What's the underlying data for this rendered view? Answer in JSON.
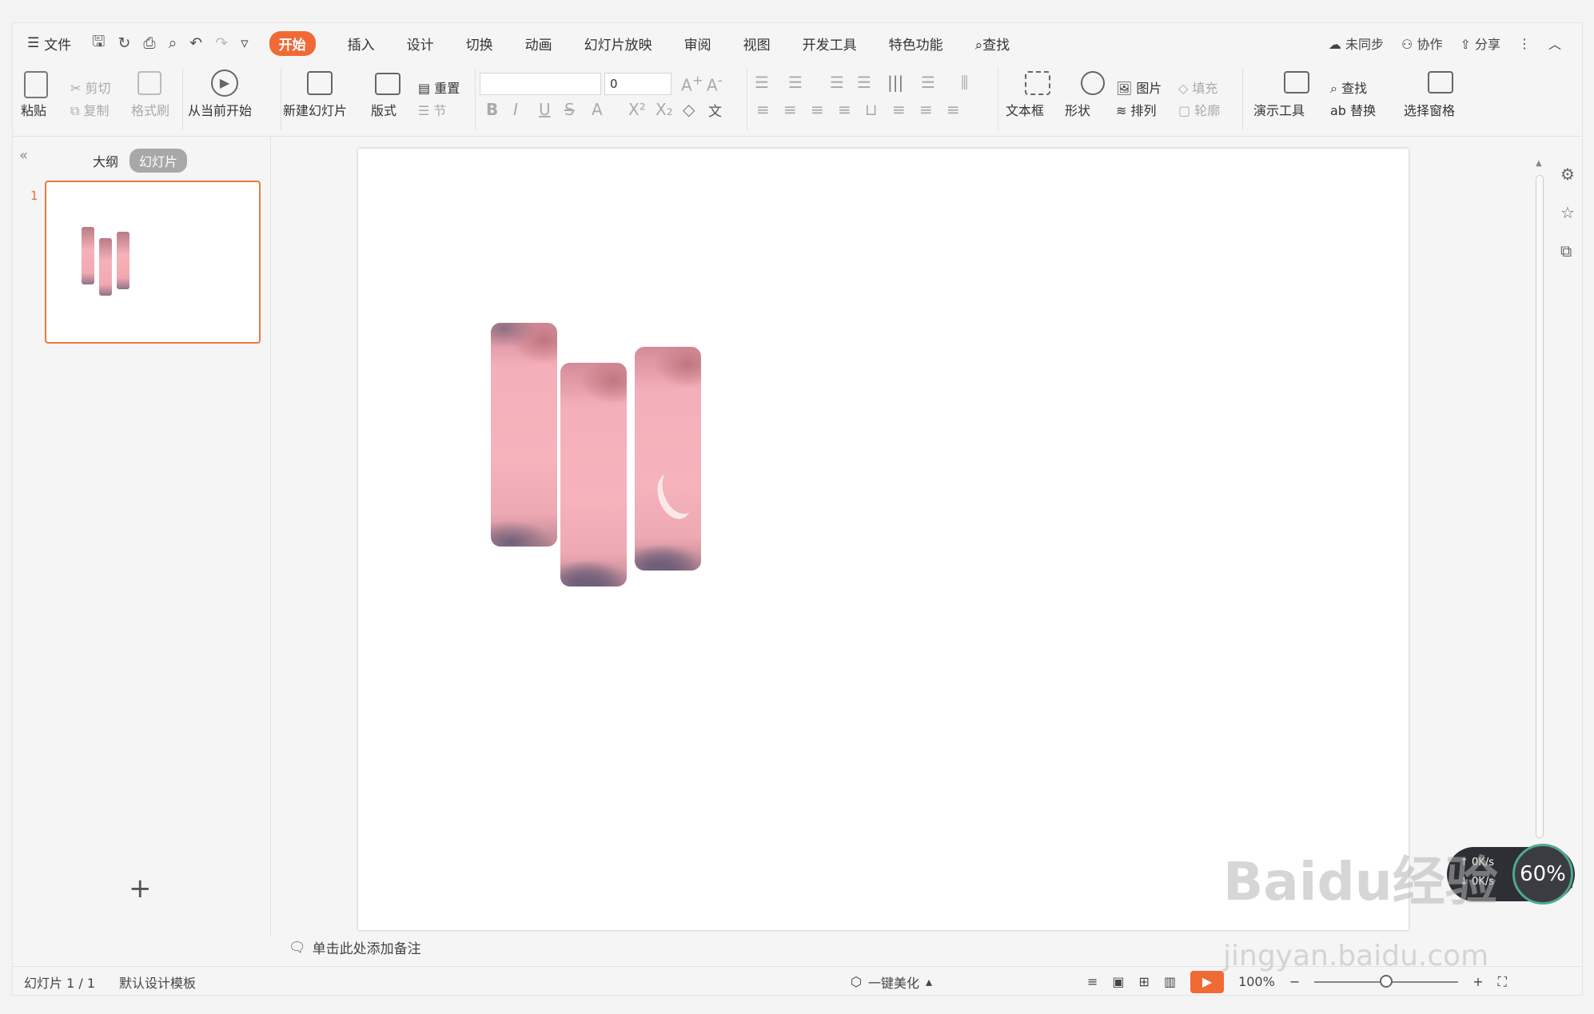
{
  "menu": {
    "file": "文件",
    "tabs": [
      "开始",
      "插入",
      "设计",
      "切换",
      "动画",
      "幻灯片放映",
      "审阅",
      "视图",
      "开发工具",
      "特色功能"
    ],
    "search": "查找",
    "sync": "未同步",
    "collab": "协作",
    "share": "分享"
  },
  "ribbon": {
    "paste": "粘贴",
    "cut": "剪切",
    "copy": "复制",
    "format_painter": "格式刷",
    "play_from_current": "从当前开始",
    "new_slide": "新建幻灯片",
    "layout": "版式",
    "reset": "重置",
    "section": "节",
    "font_size": "0",
    "textbox": "文本框",
    "shape": "形状",
    "picture": "图片",
    "fill": "填充",
    "arrange": "排列",
    "outline": "轮廓",
    "present_tools": "演示工具",
    "find": "查找",
    "replace": "替换",
    "select_pane": "选择窗格"
  },
  "left_panel": {
    "outline_tab": "大纲",
    "slides_tab": "幻灯片",
    "slide_number": "1"
  },
  "notes_placeholder": "单击此处添加备注",
  "status": {
    "slide_info": "幻灯片 1 / 1",
    "template": "默认设计模板",
    "beautify": "一键美化",
    "zoom": "100%"
  },
  "speed_widget": {
    "upload": "0K/s",
    "download": "0K/s",
    "percent": "60%"
  },
  "watermark": {
    "brand": "Baidu经验",
    "url": "jingyan.baidu.com"
  },
  "colors": {
    "accent": "#f06a35",
    "thumb_border": "#e97a3d"
  }
}
